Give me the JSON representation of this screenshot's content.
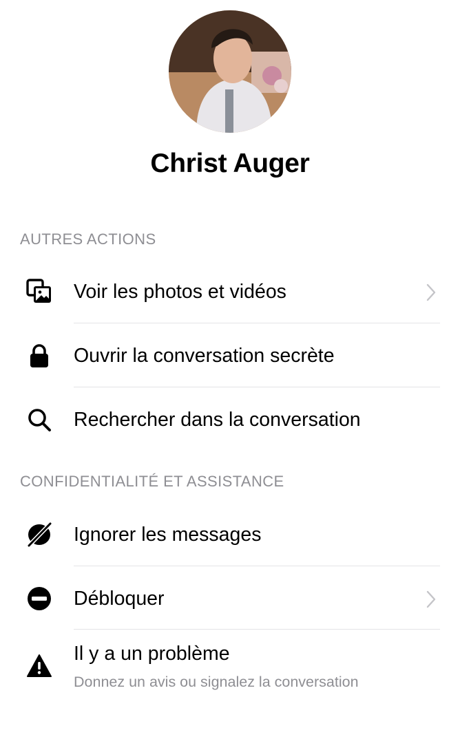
{
  "profile": {
    "name": "Christ Auger"
  },
  "sections": {
    "actions": {
      "title": "AUTRES ACTIONS",
      "items": [
        {
          "label": "Voir les photos et vidéos",
          "icon": "photos-icon",
          "chevron": true
        },
        {
          "label": "Ouvrir la conversation secrète",
          "icon": "lock-icon",
          "chevron": false
        },
        {
          "label": "Rechercher dans la conversation",
          "icon": "search-icon",
          "chevron": false
        }
      ]
    },
    "privacy": {
      "title": "CONFIDENTIALITÉ ET ASSISTANCE",
      "items": [
        {
          "label": "Ignorer les messages",
          "icon": "ignore-icon",
          "chevron": false
        },
        {
          "label": "Débloquer",
          "icon": "unblock-icon",
          "chevron": true
        },
        {
          "label": "Il y a un problème",
          "sublabel": "Donnez un avis ou signalez la conversation",
          "icon": "warning-icon",
          "chevron": false
        }
      ]
    }
  },
  "colors": {
    "text": "#000000",
    "secondary": "#8e8e93",
    "divider": "#e3e3e6"
  }
}
